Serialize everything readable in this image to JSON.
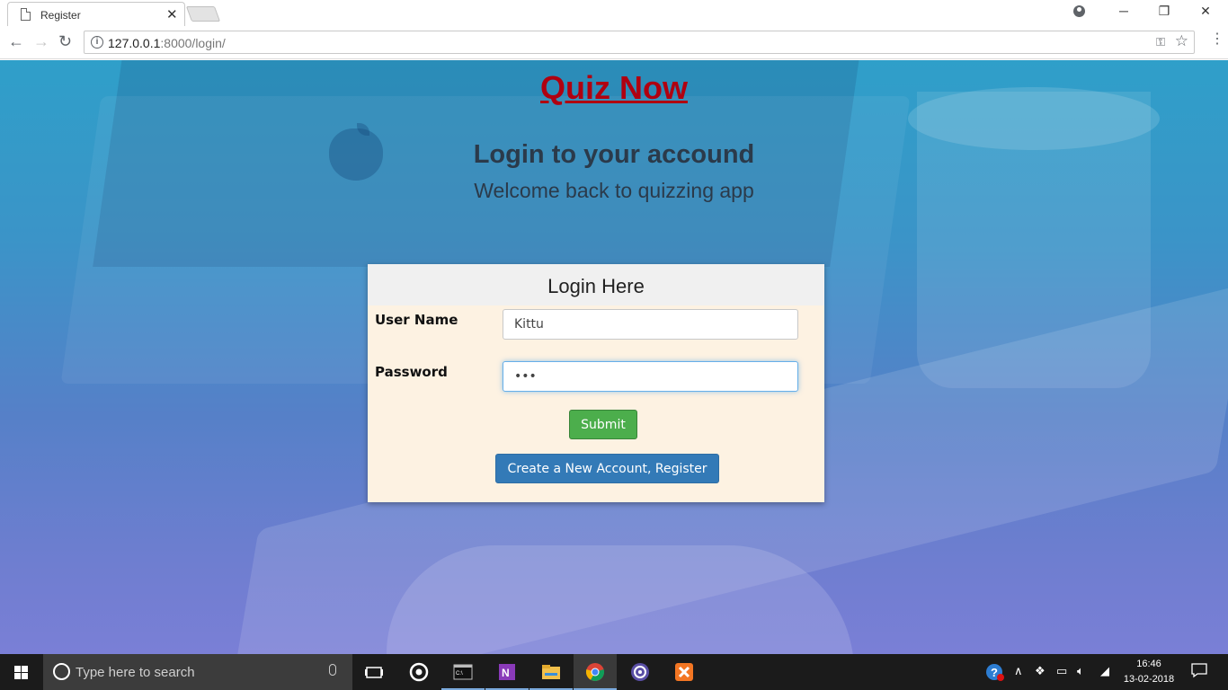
{
  "browser": {
    "tab_title": "Register",
    "url_host": "127.0.0.1",
    "url_path": ":8000/login/"
  },
  "page": {
    "site_title": "Quiz Now",
    "heading": "Login to your accound",
    "subheading": "Welcome back to quizzing app",
    "panel_title": "Login Here",
    "username_label": "User Name",
    "username_value": "Kittu",
    "password_label": "Password",
    "password_value": "•••",
    "submit_label": "Submit",
    "register_label": "Create a New Account, Register"
  },
  "taskbar": {
    "search_placeholder": "Type here to search",
    "time": "16:46",
    "date": "13-02-2018"
  },
  "colors": {
    "title_red": "#b00010",
    "submit_green": "#4cae4c",
    "register_blue": "#337ab7",
    "panel_bg": "#fdf2e2"
  }
}
